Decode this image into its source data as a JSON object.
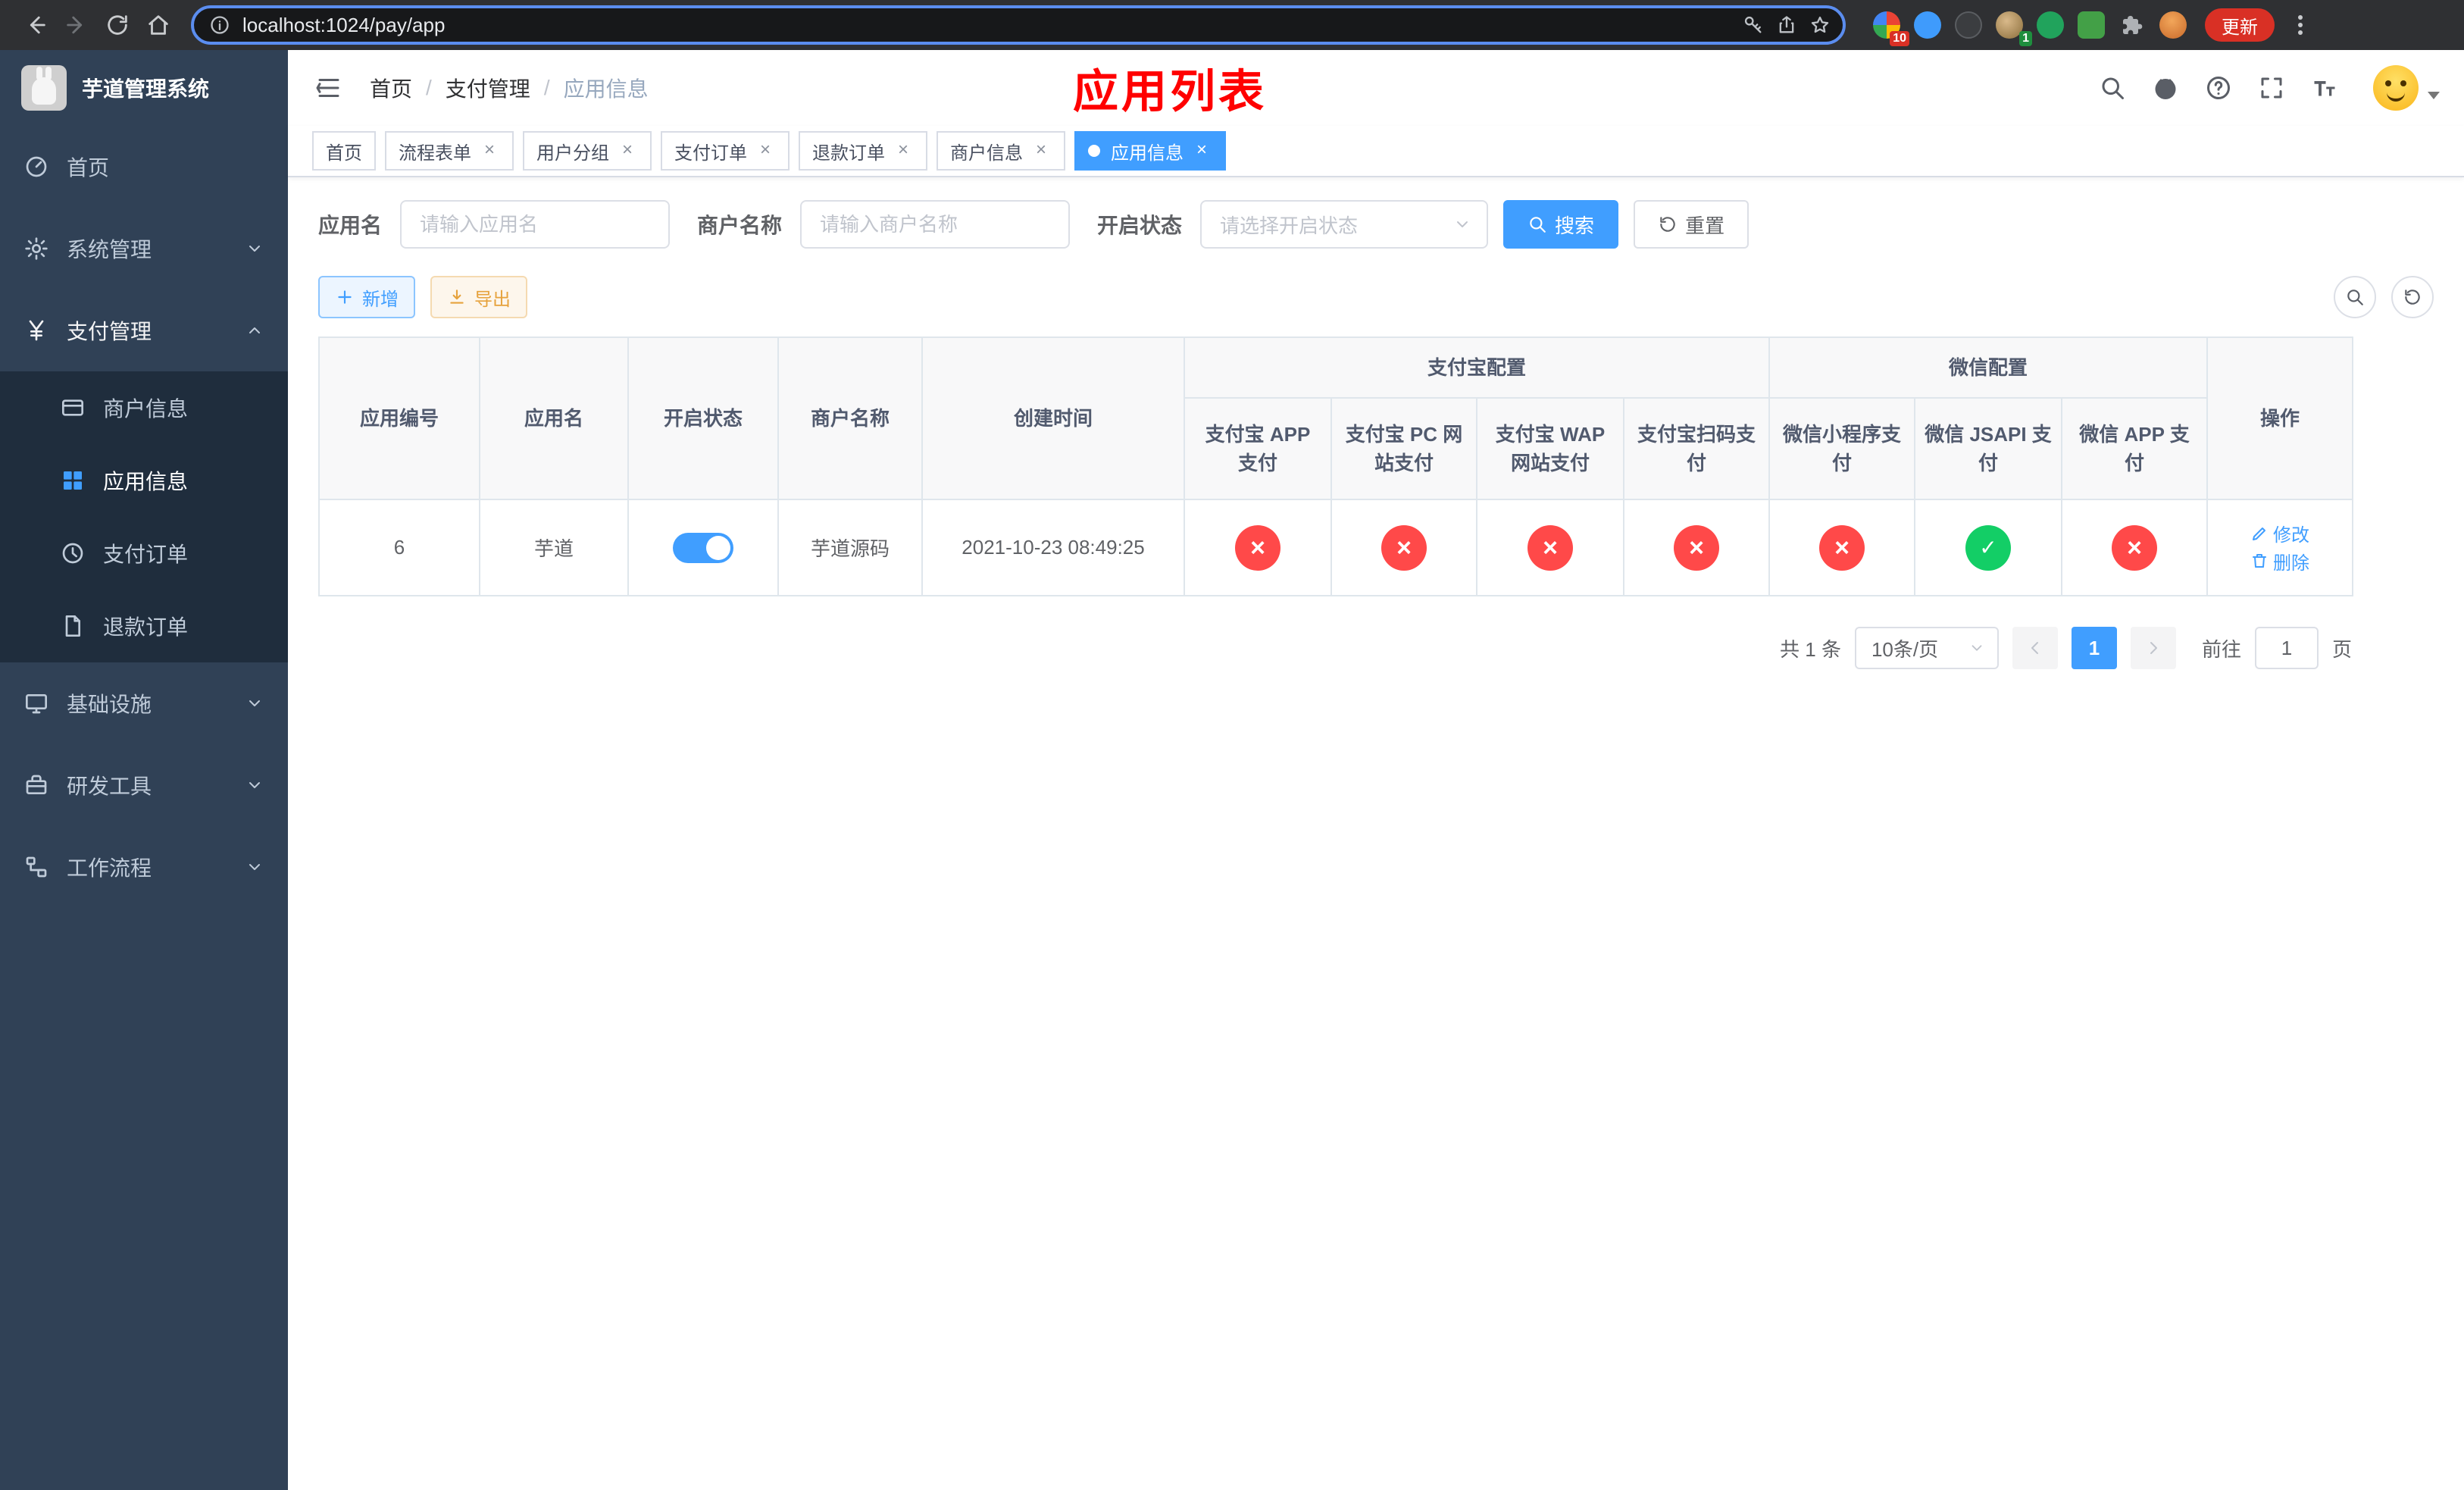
{
  "colors": {
    "accent": "#409eff",
    "success": "#13ce66",
    "danger": "#ff4949",
    "title_red": "#ff0000",
    "sidebar_bg": "#304156"
  },
  "chrome": {
    "url": "localhost:1024/pay/app",
    "update_label": "更新",
    "extension_badges": {
      "grid": "10",
      "avatar": "1"
    }
  },
  "sidebar": {
    "brand": "芋道管理系统",
    "items": [
      {
        "label": "首页"
      },
      {
        "label": "系统管理"
      },
      {
        "label": "支付管理",
        "children": [
          {
            "label": "商户信息"
          },
          {
            "label": "应用信息",
            "active": true
          },
          {
            "label": "支付订单"
          },
          {
            "label": "退款订单"
          }
        ]
      },
      {
        "label": "基础设施"
      },
      {
        "label": "研发工具"
      },
      {
        "label": "工作流程"
      }
    ]
  },
  "header": {
    "breadcrumb": [
      "首页",
      "支付管理",
      "应用信息"
    ],
    "title": "应用列表"
  },
  "tabs": [
    {
      "label": "首页"
    },
    {
      "label": "流程表单"
    },
    {
      "label": "用户分组"
    },
    {
      "label": "支付订单"
    },
    {
      "label": "退款订单"
    },
    {
      "label": "商户信息"
    },
    {
      "label": "应用信息",
      "active": true
    }
  ],
  "filters": {
    "app_name": {
      "label": "应用名",
      "placeholder": "请输入应用名",
      "value": ""
    },
    "merchant_name": {
      "label": "商户名称",
      "placeholder": "请输入商户名称",
      "value": ""
    },
    "status": {
      "label": "开启状态",
      "placeholder": "请选择开启状态"
    },
    "search_button": "搜索",
    "reset_button": "重置"
  },
  "toolbar": {
    "add_button": "新增",
    "export_button": "导出"
  },
  "table": {
    "columns": [
      "应用编号",
      "应用名",
      "开启状态",
      "商户名称",
      "创建时间"
    ],
    "groups": [
      {
        "label": "支付宝配置",
        "columns": [
          "支付宝 APP 支付",
          "支付宝 PC 网站支付",
          "支付宝 WAP 网站支付",
          "支付宝扫码支付"
        ]
      },
      {
        "label": "微信配置",
        "columns": [
          "微信小程序支付",
          "微信 JSAPI 支付",
          "微信 APP 支付"
        ]
      }
    ],
    "ops_column": "操作",
    "rows": [
      {
        "app_id": "6",
        "app_name": "芋道",
        "enabled": true,
        "merchant_name": "芋道源码",
        "create_time": "2021-10-23 08:49:25",
        "configs": [
          false,
          false,
          false,
          false,
          false,
          true,
          false
        ],
        "actions": {
          "edit": "修改",
          "delete": "删除"
        }
      }
    ]
  },
  "pagination": {
    "total": "共 1 条",
    "page_size": "10条/页",
    "current_page": "1",
    "goto_prefix": "前往",
    "goto_value": "1",
    "goto_suffix": "页"
  }
}
